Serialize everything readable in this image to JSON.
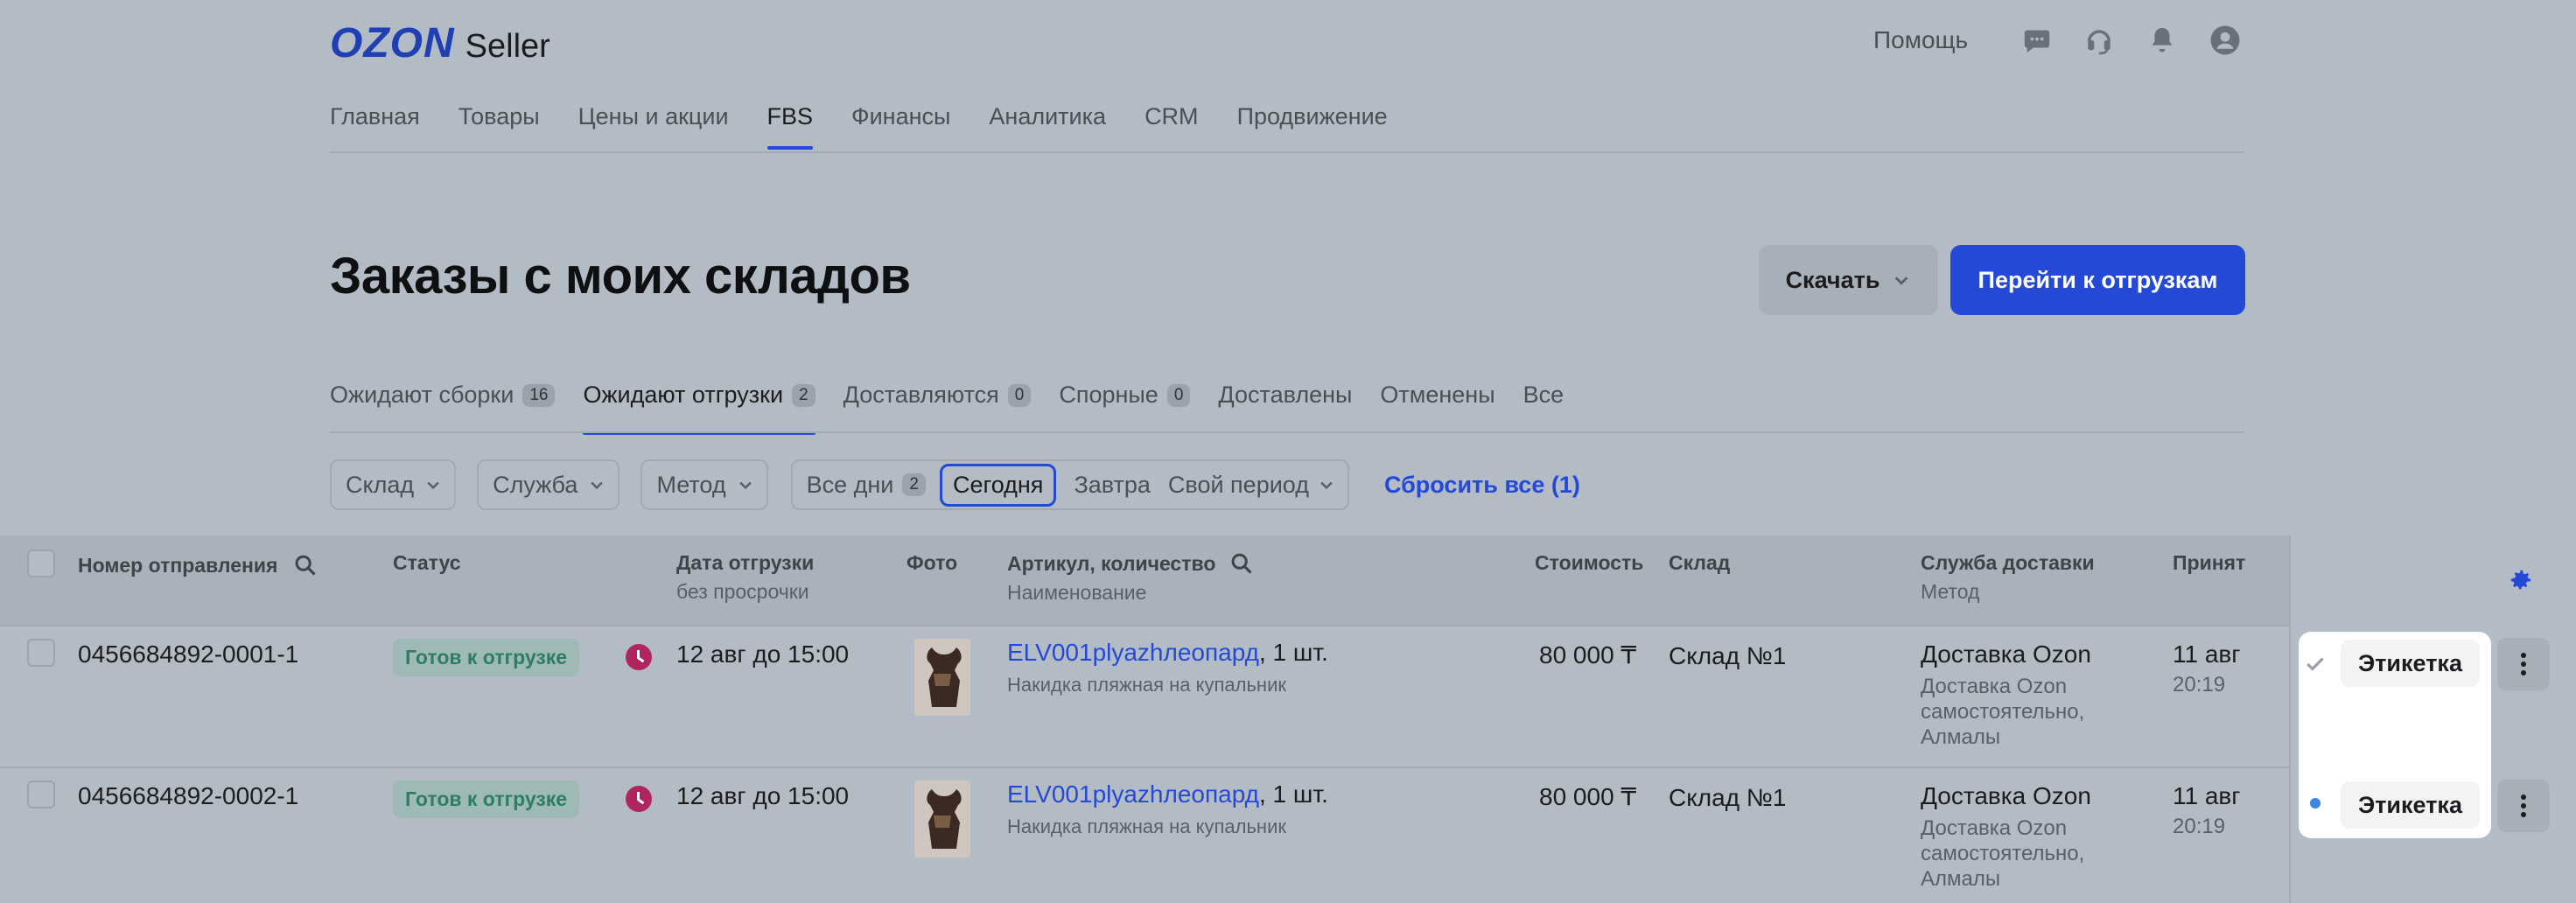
{
  "header": {
    "logo_ozon": "OZON",
    "logo_seller": "Seller",
    "help": "Помощь",
    "nav": [
      "Главная",
      "Товары",
      "Цены и акции",
      "FBS",
      "Финансы",
      "Аналитика",
      "CRM",
      "Продвижение"
    ],
    "nav_active_index": 3
  },
  "page": {
    "title": "Заказы с моих складов",
    "download_label": "Скачать",
    "go_shipments_label": "Перейти к отгрузкам"
  },
  "status_tabs": [
    {
      "label": "Ожидают сборки",
      "count": "16"
    },
    {
      "label": "Ожидают отгрузки",
      "count": "2"
    },
    {
      "label": "Доставляются",
      "count": "0"
    },
    {
      "label": "Спорные",
      "count": "0"
    },
    {
      "label": "Доставлены",
      "count": ""
    },
    {
      "label": "Отменены",
      "count": ""
    },
    {
      "label": "Все",
      "count": ""
    }
  ],
  "filters": {
    "warehouse": "Склад",
    "service": "Служба",
    "method": "Метод",
    "all_days": "Все дни",
    "all_days_count": "2",
    "today": "Сегодня",
    "tomorrow": "Завтра",
    "custom_period": "Свой период",
    "reset": "Сбросить все (1)"
  },
  "table": {
    "columns": {
      "shipment_number": "Номер отправления",
      "status": "Статус",
      "ship_date": "Дата отгрузки",
      "ship_date_sub": "без просрочки",
      "photo": "Фото",
      "article": "Артикул, количество",
      "article_sub": "Наименование",
      "cost": "Стоимость",
      "warehouse": "Склад",
      "delivery": "Служба доставки",
      "delivery_sub": "Метод",
      "accepted": "Принят"
    },
    "rows": [
      {
        "number": "0456684892-0001-1",
        "status": "Готов к отгрузке",
        "date": "12 авг до 15:00",
        "article": "ELV001plyazhлеопард",
        "qty": ", 1 шт.",
        "name": "Накидка пляжная на купальник",
        "cost": "80 000 ₸",
        "warehouse": "Склад №1",
        "delivery": "Доставка Ozon",
        "method_1": "Доставка Ozon",
        "method_2": "самостоятельно,",
        "method_3": "Алмалы",
        "accepted_date": "11 авг",
        "accepted_time": "20:19",
        "label": "Этикетка"
      },
      {
        "number": "0456684892-0002-1",
        "status": "Готов к отгрузке",
        "date": "12 авг до 15:00",
        "article": "ELV001plyazhлеопард",
        "qty": ", 1 шт.",
        "name": "Накидка пляжная на купальник",
        "cost": "80 000 ₸",
        "warehouse": "Склад №1",
        "delivery": "Доставка Ozon",
        "method_1": "Доставка Ozon",
        "method_2": "самостоятельно,",
        "method_3": "Алмалы",
        "accepted_date": "11 авг",
        "accepted_time": "20:19",
        "label": "Этикетка"
      }
    ]
  },
  "colors": {
    "accent": "#2349d6",
    "status_green": "#2e7d63",
    "clock_magenta": "#b0245f",
    "overlay_bg": "#b3bcc4"
  },
  "icons": [
    "chat-icon",
    "headset-icon",
    "bell-icon",
    "account-icon",
    "search-icon",
    "chevron-down-icon",
    "gear-icon",
    "check-icon",
    "dot-icon",
    "kebab-icon",
    "clock-icon"
  ]
}
